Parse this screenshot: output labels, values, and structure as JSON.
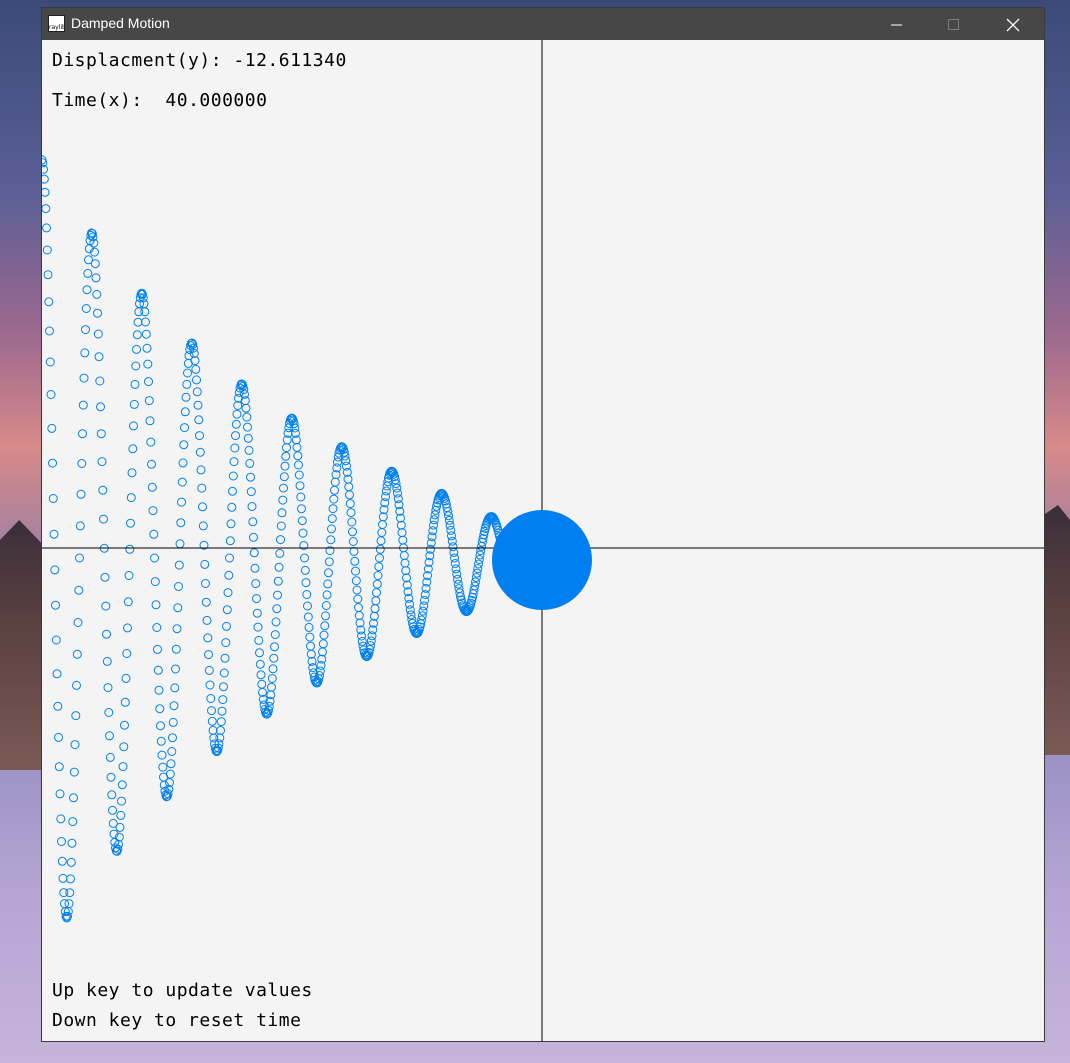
{
  "window": {
    "title": "Damped Motion",
    "icon_text": "raylib"
  },
  "controls": {
    "minimize_icon": "minimize-icon",
    "maximize_icon": "maximize-icon",
    "close_icon": "close-icon"
  },
  "hud": {
    "displacement_label": "Displacment(y):",
    "displacement_value": "-12.611340",
    "time_label": "Time(x):",
    "time_value": "40.000000",
    "hint_up": "Up key to update values",
    "hint_down": "Down key to reset time"
  },
  "colors": {
    "background": "#f4f4f4",
    "trail": "#0080f0",
    "ball": "#0080f0",
    "axis": "#000000",
    "titlebar": "#474747"
  },
  "simulation": {
    "time": 40.0,
    "displacement": -12.61134
  }
}
